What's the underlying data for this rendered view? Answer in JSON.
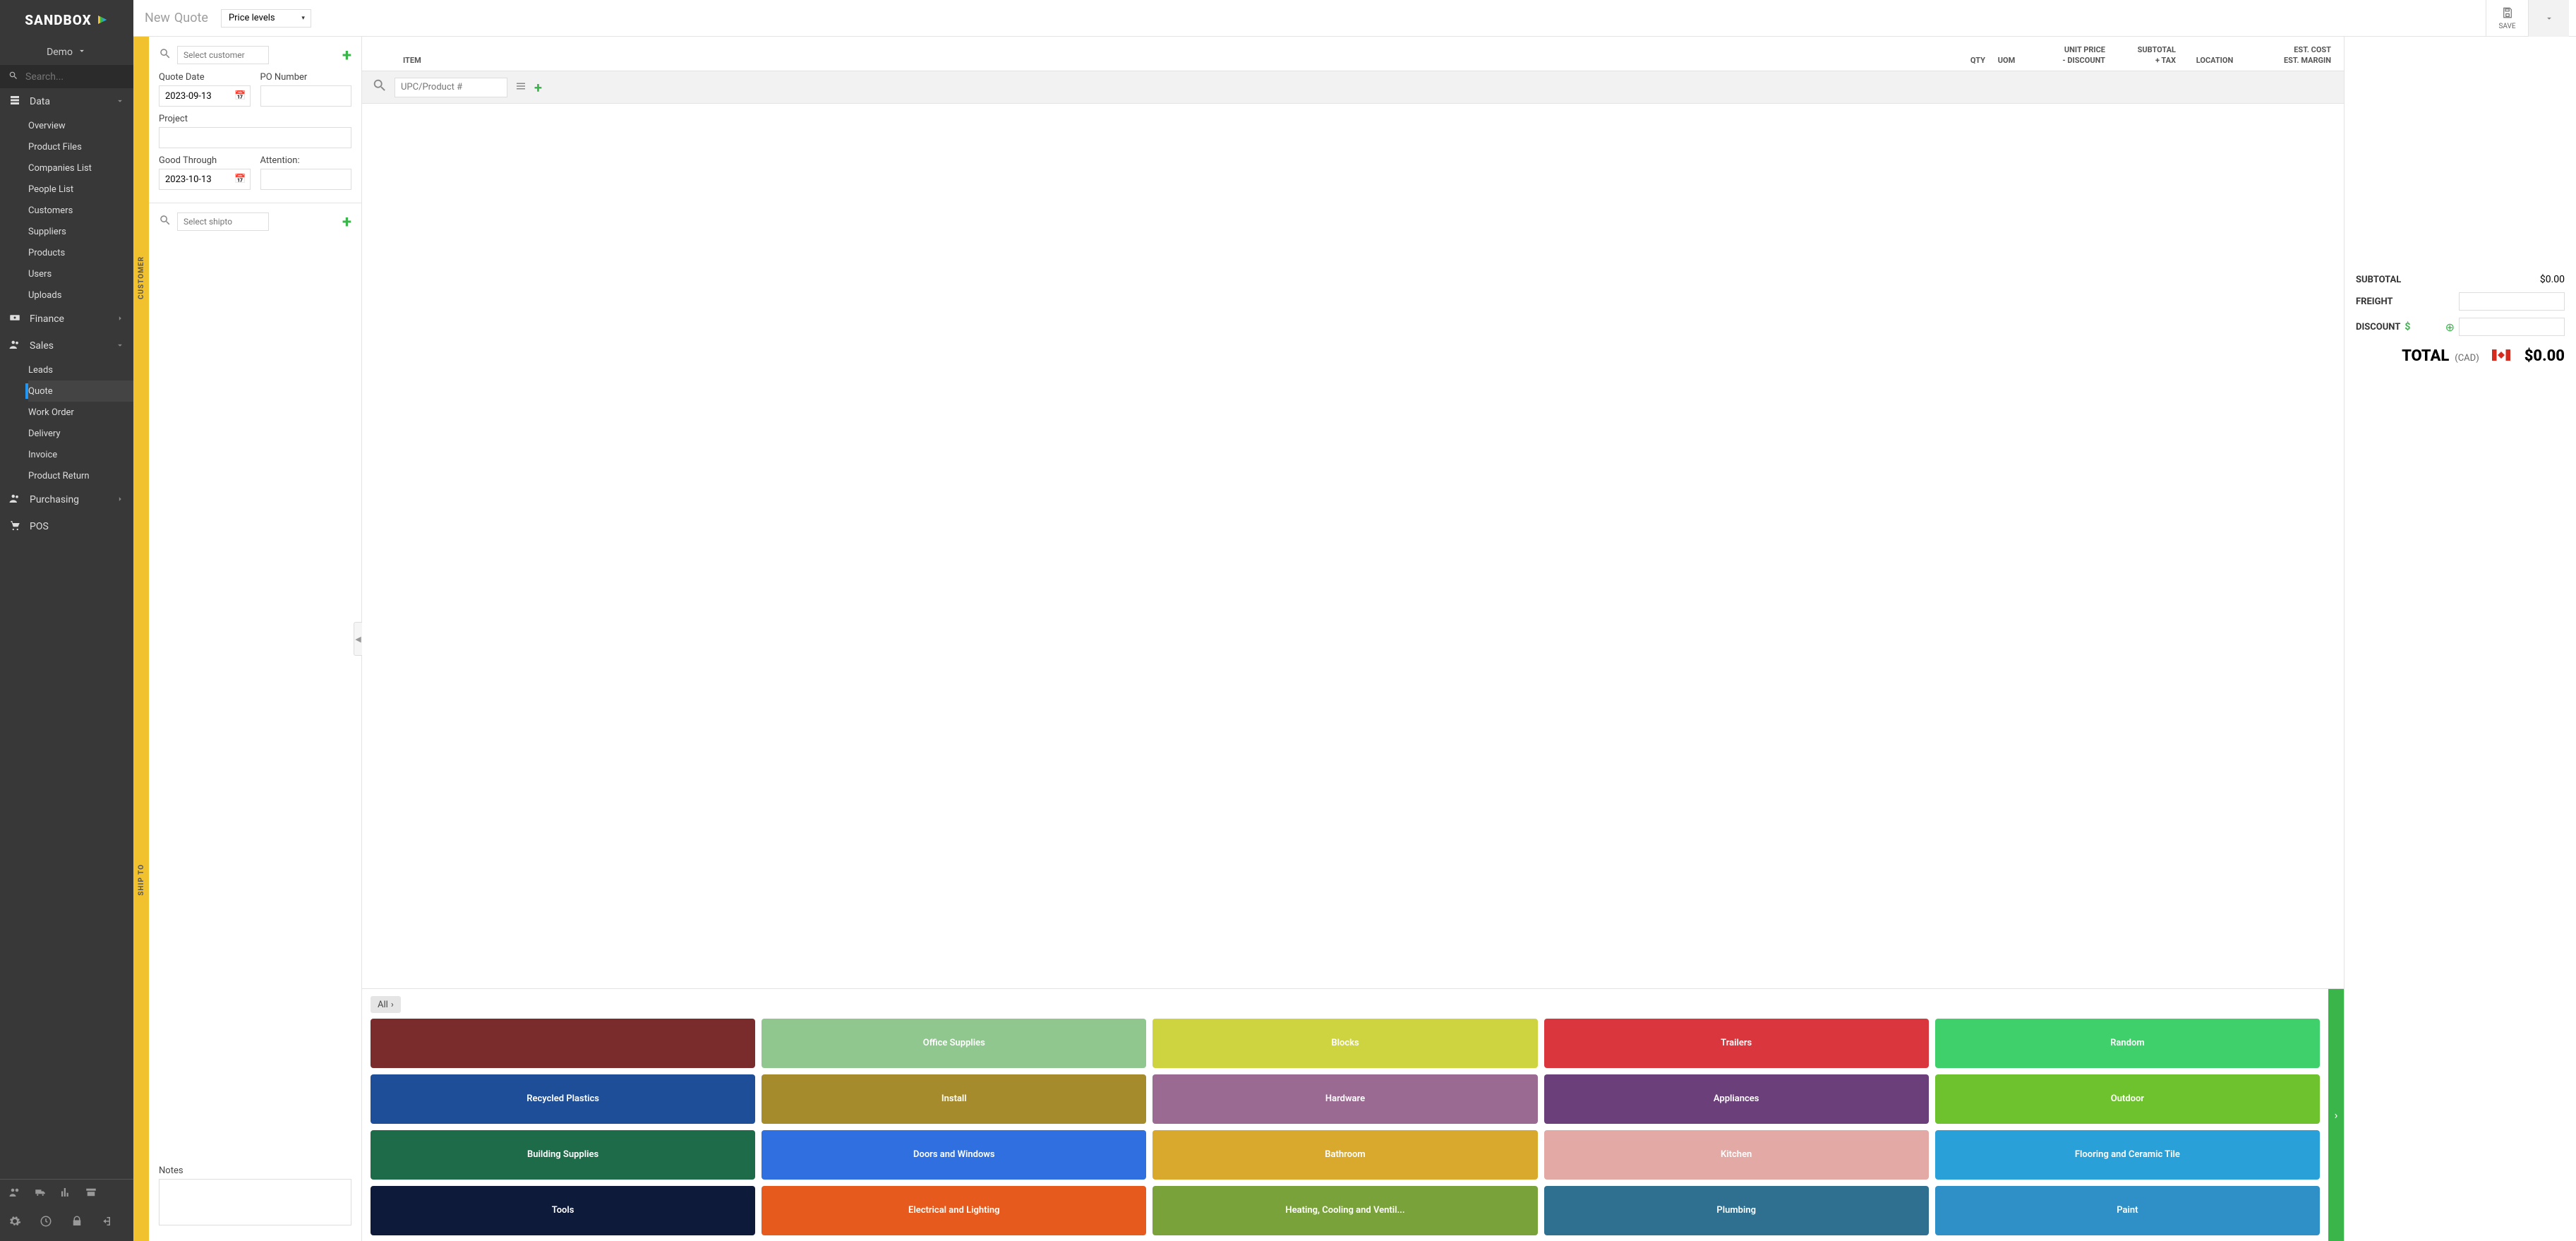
{
  "brand": "SANDBOX",
  "workspace": "Demo",
  "search_placeholder": "Search...",
  "nav": {
    "data": {
      "label": "Data",
      "expanded": true,
      "items": [
        "Overview",
        "Product Files",
        "Companies List",
        "People List",
        "Customers",
        "Suppliers",
        "Products",
        "Users",
        "Uploads"
      ]
    },
    "finance": {
      "label": "Finance"
    },
    "sales": {
      "label": "Sales",
      "expanded": true,
      "items": [
        "Leads",
        "Quote",
        "Work Order",
        "Delivery",
        "Invoice",
        "Product Return"
      ],
      "active": "Quote"
    },
    "purchasing": {
      "label": "Purchasing"
    },
    "pos": {
      "label": "POS"
    }
  },
  "page": {
    "new_label": "New",
    "entity_label": "Quote",
    "price_levels": "Price levels",
    "save": "SAVE"
  },
  "rails": {
    "customer": "CUSTOMER",
    "shipto": "SHIP TO"
  },
  "customer": {
    "select_placeholder": "Select customer",
    "quote_date_label": "Quote Date",
    "quote_date": "2023-09-13",
    "po_label": "PO Number",
    "po_value": "",
    "project_label": "Project",
    "project_value": "",
    "good_through_label": "Good Through",
    "good_through": "2023-10-13",
    "attention_label": "Attention:",
    "attention_value": ""
  },
  "shipto": {
    "select_placeholder": "Select shipto",
    "notes_label": "Notes",
    "notes_value": ""
  },
  "items": {
    "headers": {
      "item": "ITEM",
      "qty": "QTY",
      "uom": "UOM",
      "unit_price": "UNIT PRICE",
      "discount": "- DISCOUNT",
      "subtotal": "SUBTOTAL",
      "tax": "+ TAX",
      "location": "LOCATION",
      "est_cost": "EST. COST",
      "est_margin": "EST. MARGIN"
    },
    "upc_placeholder": "UPC/Product #",
    "crumb_all": "All"
  },
  "categories": [
    {
      "label": "",
      "color": "#7a2b2b"
    },
    {
      "label": "Office Supplies",
      "color": "#8fc78f"
    },
    {
      "label": "Blocks",
      "color": "#cdd43f"
    },
    {
      "label": "Trailers",
      "color": "#d9363e"
    },
    {
      "label": "Random",
      "color": "#3fcf6b"
    },
    {
      "label": "Recycled Plastics",
      "color": "#1f4e99"
    },
    {
      "label": "Install",
      "color": "#a68b2d"
    },
    {
      "label": "Hardware",
      "color": "#9a6a93"
    },
    {
      "label": "Appliances",
      "color": "#6b3f7a"
    },
    {
      "label": "Outdoor",
      "color": "#6ec22e"
    },
    {
      "label": "Building Supplies",
      "color": "#1e6b4a"
    },
    {
      "label": "Doors and Windows",
      "color": "#2f6fe0"
    },
    {
      "label": "Bathroom",
      "color": "#d9a92e"
    },
    {
      "label": "Kitchen",
      "color": "#e2a9a5"
    },
    {
      "label": "Flooring and Ceramic Tile",
      "color": "#2aa0d8"
    },
    {
      "label": "Tools",
      "color": "#0d1a3a"
    },
    {
      "label": "Electrical and Lighting",
      "color": "#e65a1e"
    },
    {
      "label": "Heating, Cooling and Ventil...",
      "color": "#7aa23a"
    },
    {
      "label": "Plumbing",
      "color": "#2f6f8f"
    },
    {
      "label": "Paint",
      "color": "#2f8fc7"
    }
  ],
  "totals": {
    "subtotal_label": "SUBTOTAL",
    "subtotal": "$0.00",
    "freight_label": "FREIGHT",
    "freight": "",
    "discount_label": "DISCOUNT",
    "discount": "",
    "total_label": "TOTAL",
    "currency": "(CAD)",
    "total": "$0.00"
  }
}
